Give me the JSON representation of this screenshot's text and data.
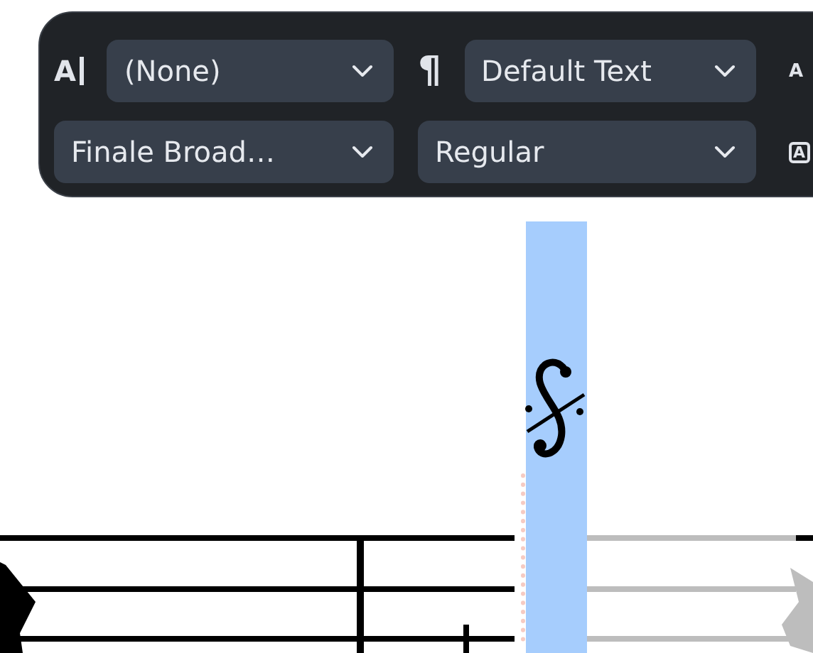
{
  "toolbar": {
    "rows": [
      [
        {
          "icon": {
            "kind": "char-style",
            "glyph": "A"
          },
          "value": "(None)"
        },
        {
          "icon": {
            "kind": "para-style",
            "glyph": "¶"
          },
          "value": "Default Text"
        },
        {
          "icon": {
            "kind": "size",
            "glyph": "A"
          }
        }
      ],
      [
        {
          "value": "Finale Broad…"
        },
        {
          "value": "Regular"
        },
        {
          "icon": {
            "kind": "frame",
            "glyph": "A"
          }
        }
      ]
    ]
  },
  "score": {
    "segno": {
      "selected": true
    }
  }
}
